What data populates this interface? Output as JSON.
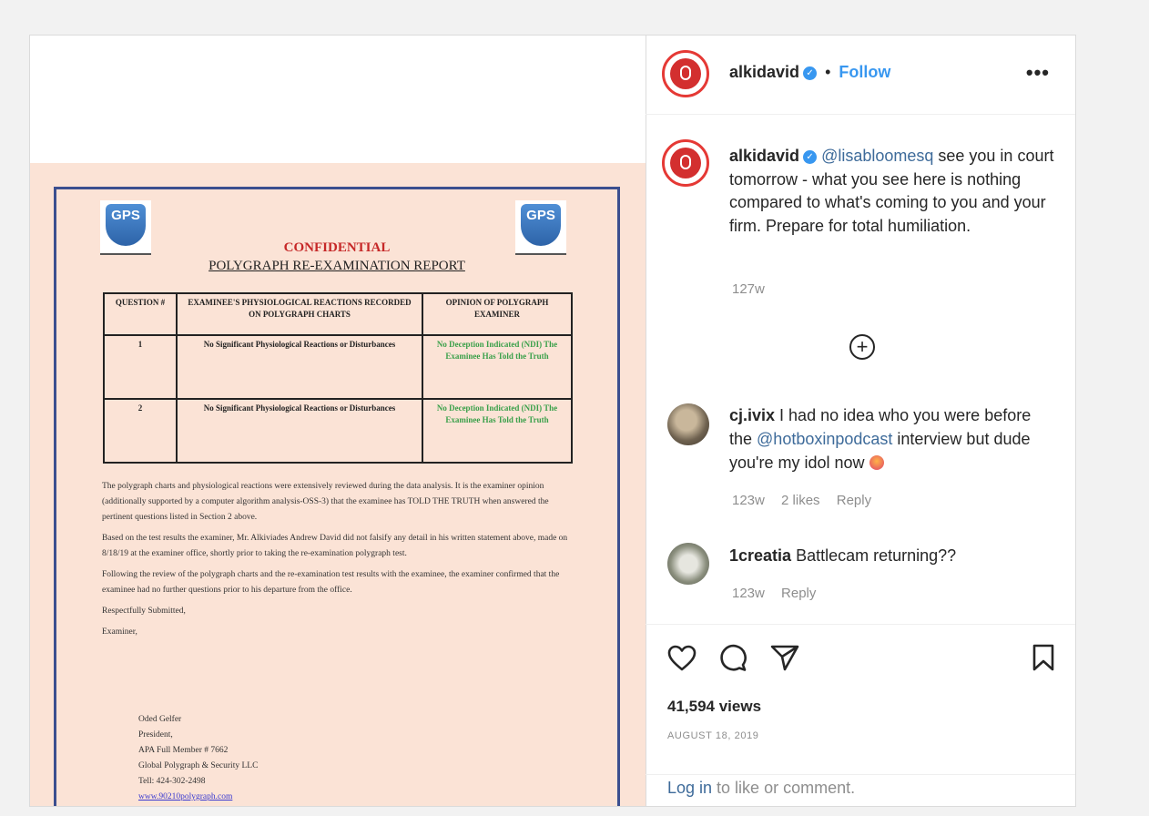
{
  "post": {
    "username": "alkidavid",
    "follow_separator": "•",
    "follow_label": "Follow",
    "more_label": "•••"
  },
  "caption": {
    "username": "alkidavid",
    "mention": "@lisabloomesq",
    "text": " see you in court tomorrow - what you see here is nothing compared to what's coming to you and your firm. Prepare for total humiliation.",
    "time": "127w"
  },
  "comments": [
    {
      "username": "cj.ivix",
      "text_before": " I had no idea who you were before the ",
      "mention": "@hotboxinpodcast",
      "text_after": " interview but dude you're my idol now ",
      "time": "123w",
      "likes": "2 likes",
      "reply_label": "Reply"
    },
    {
      "username": "1creatia",
      "text": " Battlecam returning??",
      "time": "123w",
      "reply_label": "Reply"
    }
  ],
  "stats": {
    "views": "41,594 views",
    "date": "AUGUST 18, 2019"
  },
  "login": {
    "link": "Log in",
    "rest": " to like or comment."
  },
  "icons": {
    "like": "heart-icon",
    "comment": "comment-icon",
    "share": "send-icon",
    "save": "bookmark-icon",
    "load_more": "plus-circle-icon"
  },
  "document": {
    "logo_text": "GPS",
    "title": "CONFIDENTIAL",
    "subtitle": "POLYGRAPH RE-EXAMINATION REPORT",
    "table_headers": [
      "QUESTION #",
      "EXAMINEE'S PHYSIOLOGICAL REACTIONS RECORDED ON POLYGRAPH CHARTS",
      "OPINION OF POLYGRAPH EXAMINER"
    ],
    "table_rows": [
      [
        "1",
        "No Significant Physiological Reactions or Disturbances",
        "No Deception Indicated (NDI) The Examinee Has Told the Truth"
      ],
      [
        "2",
        "No Significant Physiological Reactions or Disturbances",
        "No Deception Indicated (NDI) The Examinee Has Told the Truth"
      ]
    ],
    "para1": "The polygraph charts and physiological reactions were extensively reviewed during the data analysis. It is the examiner opinion (additionally supported by a computer algorithm analysis-OSS-3) that the examinee has TOLD THE TRUTH when answered the pertinent questions listed in Section 2 above.",
    "para2": "Based on the test results the examiner, Mr. Alkiviades Andrew David did not falsify any detail in his written statement above, made on 8/18/19 at the examiner office, shortly prior to taking the re-examination polygraph test.",
    "para3": "Following the review of the polygraph charts and the re-examination test results with the examinee, the examiner confirmed that the examinee had no further questions prior to his departure from the office.",
    "para4": "Respectfully Submitted,",
    "para5": "Examiner,",
    "sign_lines": [
      "Oded Gelfer",
      "President,",
      "APA Full Member # 7662",
      "Global Polygraph & Security LLC",
      "Tell: 424-302-2498"
    ],
    "sign_link": "www.90210polygraph.com"
  },
  "colors": {
    "accent": "#3897f0",
    "link": "#3e6b9a",
    "doc_background": "#fbe3d6",
    "doc_title_red": "#c62828",
    "ndi_green": "#3aa04a"
  }
}
